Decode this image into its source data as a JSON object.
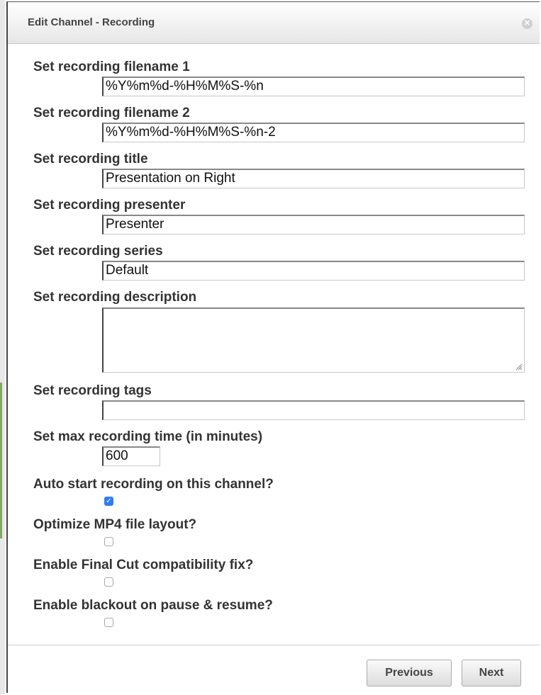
{
  "dialog": {
    "title": "Edit Channel - Recording",
    "close_icon": "close-circle-icon"
  },
  "form": {
    "filename1": {
      "label": "Set recording filename 1",
      "value": "%Y%m%d-%H%M%S-%n"
    },
    "filename2": {
      "label": "Set recording filename 2",
      "value": "%Y%m%d-%H%M%S-%n-2"
    },
    "title": {
      "label": "Set recording title",
      "value": "Presentation on Right"
    },
    "presenter": {
      "label": "Set recording presenter",
      "value": "Presenter"
    },
    "series": {
      "label": "Set recording series",
      "value": "Default"
    },
    "description": {
      "label": "Set recording description",
      "value": ""
    },
    "tags": {
      "label": "Set recording tags",
      "value": ""
    },
    "max_time": {
      "label": "Set max recording time (in minutes)",
      "value": "600"
    },
    "auto_start": {
      "label": "Auto start recording on this channel?",
      "checked": true
    },
    "optimize_mp4": {
      "label": "Optimize MP4 file layout?",
      "checked": false
    },
    "final_cut_fix": {
      "label": "Enable Final Cut compatibility fix?",
      "checked": false
    },
    "blackout": {
      "label": "Enable blackout on pause & resume?",
      "checked": false
    }
  },
  "footer": {
    "previous_label": "Previous",
    "next_label": "Next"
  },
  "colors": {
    "checkbox_checked": "#2f7cf6"
  }
}
